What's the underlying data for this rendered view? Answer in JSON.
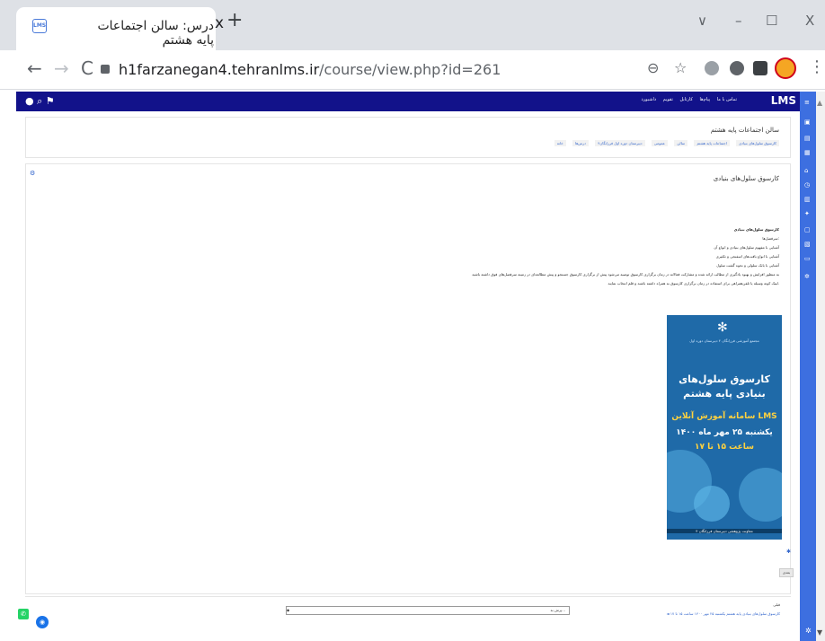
{
  "browser": {
    "tab_title": "درس: سالن اجتماعات پایه هشتم",
    "tab_favicon_text": "LMS",
    "tab_close": "x",
    "new_tab": "+",
    "win_min": "–",
    "win_max": "☐",
    "win_close": "X",
    "win_down": "∨",
    "url_host": "h1farzanegan4.tehranlms.ir",
    "url_path": "/course/view.php?id=261",
    "back": "←",
    "forward": "→",
    "reload": "C",
    "zoom_icon": "⊖",
    "star_icon": "☆",
    "menu_icon": "⋮"
  },
  "moodle_bar": {
    "left_icons": "● ⌕ ⚑",
    "menu": [
      "تماس با ما",
      "پیام‌ها",
      "کارتابل",
      "تقویم",
      "داشبورد"
    ],
    "logo": "LMS"
  },
  "header": {
    "course_title": "سالن اجتماعات پایه هشتم",
    "breadcrumb": [
      "خانه",
      "درس‌ها",
      "دبیرستان دوره اول فرزانگان۴",
      "عمومی",
      "سالن",
      "اجتماعات پایه هشتم",
      "کارسوق سلول‌های بنیادی"
    ]
  },
  "main": {
    "edit": "⚙",
    "section_title": "کارسوق سلول‌های بنیادی",
    "lines": [
      "کارسوق سلول‌های بنیادی",
      "سرفصل‌ها:",
      "آشنایی با مفهوم سلول‌های بنیادی و انواع آن",
      "آشنایی با انواع بافت‌های اسفنجی و تکثیری",
      "آشنایی با بانک سلولی و نحوه گشت سلول",
      "به منظور افزایش و بهبود یادگیری از مطالب ارائه شده و مشارکت فعالانه در زمان برگزاری کارسوق توصیه می‌شود پیش از برگزاری کارسوق جستجو و پیش مطالعه‌ای در زمینه سرفصل‌های فوق داشته باشید",
      "لینک کوته وسیله یا تلفن‌همراهی برای استفاده در زمان برگزاری کارسوق به همراه داشته باشند و قلم انتخاب نمایند."
    ],
    "poster": {
      "small_top": "مجتمع آموزشی فرزانگان ۴ دبیرستان دوره اول",
      "title": "کارسوق سلول‌های بنیادی پایه هشتم",
      "sub1": "سامانه آموزش آنلاین LMS",
      "sub2": "یکشنبه ۲۵ مهر ماه ۱۴۰۰",
      "sub3": "ساعت ۱۵ تا ۱۷",
      "footer": "معاونت پژوهشی دبیرستان فرزانگان ۴"
    },
    "next_button": "بعدی"
  },
  "footer": {
    "jump_placeholder": "پرش به...",
    "jump_left": "◆",
    "prev_label": "قبلی",
    "prev_link": "◄ کارسوق سلول‌های بنیادی پایه هشتم یکشنبه ۲۵ مهر ۱۴۰۰ ساعت ۱۵ تا ۱۷"
  },
  "floating": {
    "whatsapp": "✆",
    "chat": "◉"
  },
  "colors": {
    "moodle_bar": "#12128a",
    "right_bar": "#3d6fe0",
    "poster_bg": "#1f6aa8"
  }
}
